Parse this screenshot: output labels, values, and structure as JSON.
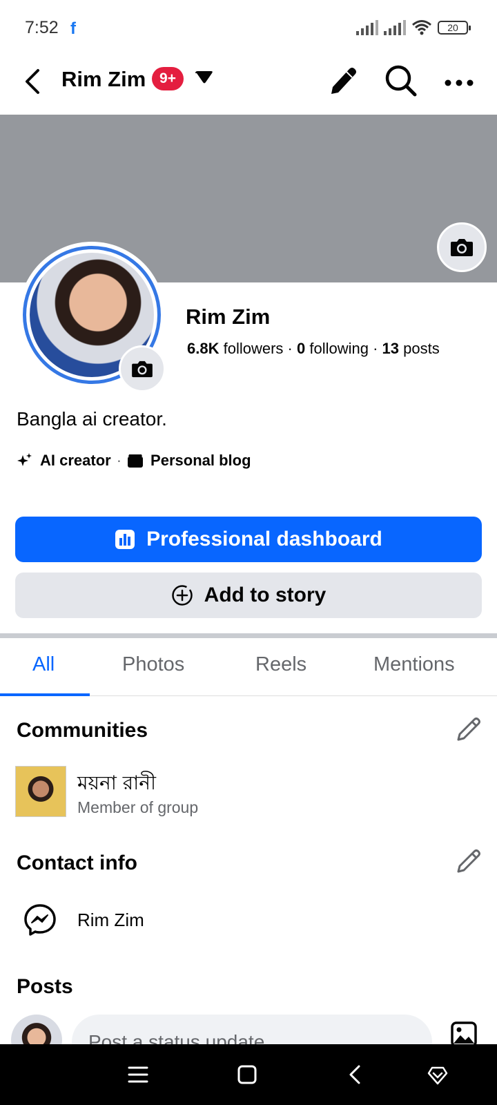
{
  "status_bar": {
    "time": "7:52",
    "app_glyph": "f",
    "battery": "20"
  },
  "header": {
    "title": "Rim Zim",
    "badge": "9+"
  },
  "profile": {
    "name": "Rim Zim",
    "followers_count": "6.8K",
    "followers_label": "followers",
    "following_count": "0",
    "following_label": "following",
    "posts_count": "13",
    "posts_label": "posts",
    "bio": "Bangla ai creator.",
    "categories": [
      {
        "label": "AI creator",
        "icon": "sparkle-icon"
      },
      {
        "label": "Personal blog",
        "icon": "clapper-icon"
      }
    ]
  },
  "buttons": {
    "dashboard": "Professional dashboard",
    "story": "Add to story"
  },
  "tabs": [
    {
      "label": "All",
      "active": true
    },
    {
      "label": "Photos",
      "active": false
    },
    {
      "label": "Reels",
      "active": false
    },
    {
      "label": "Mentions",
      "active": false
    }
  ],
  "communities": {
    "title": "Communities",
    "items": [
      {
        "name": "ময়না রানী",
        "subtitle": "Member of group"
      }
    ]
  },
  "contact": {
    "title": "Contact info",
    "messenger_name": "Rim Zim"
  },
  "posts": {
    "title": "Posts",
    "composer_placeholder": "Post a status update"
  },
  "colors": {
    "accent": "#0866ff",
    "badge": "#e41e3f",
    "cover": "#95989d",
    "button_secondary": "#e4e6eb"
  }
}
